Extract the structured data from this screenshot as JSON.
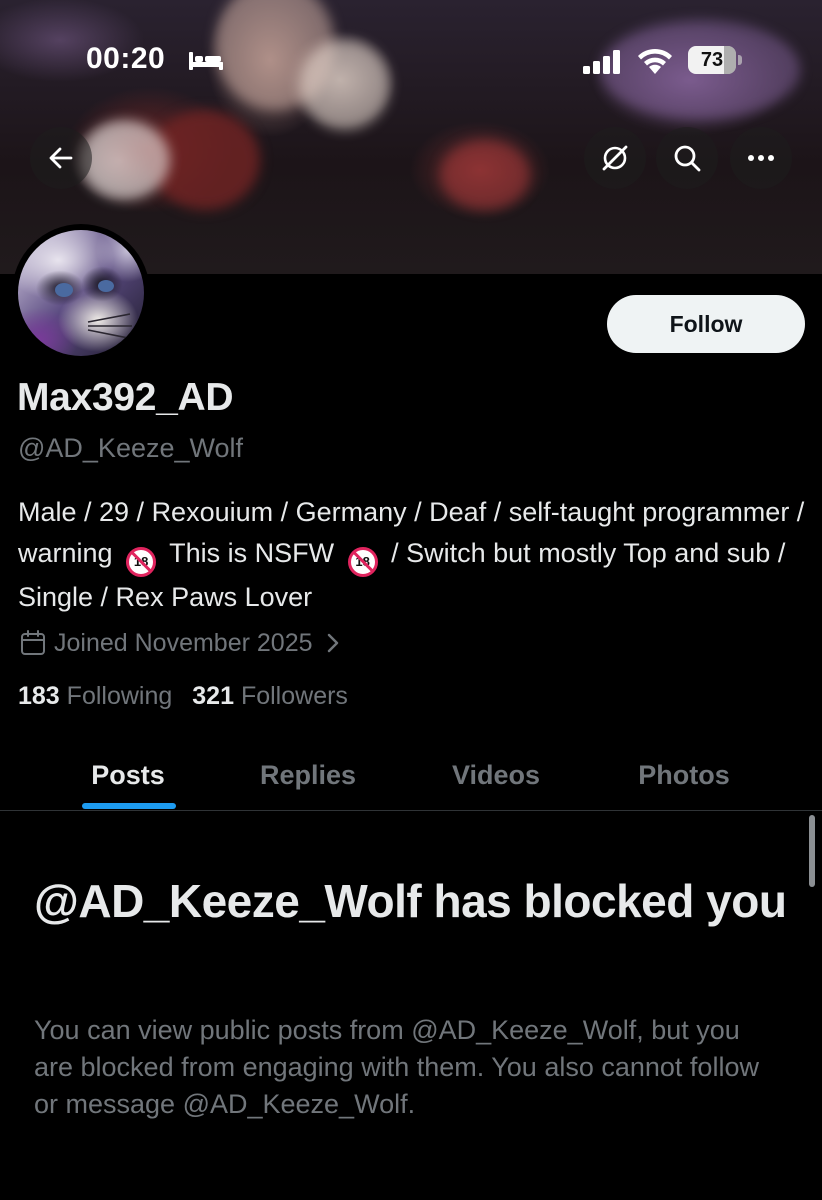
{
  "status_bar": {
    "time": "00:20",
    "battery_level": "73",
    "sleep_icon": "bed-icon",
    "signal_icon": "cellular-signal-icon",
    "wifi_icon": "wifi-icon"
  },
  "header": {
    "back_icon": "arrow-left-icon",
    "grok_icon": "grok-slash-icon",
    "search_icon": "search-icon",
    "more_icon": "more-horizontal-icon"
  },
  "profile": {
    "display_name": "Max392_AD",
    "handle": "@AD_Keeze_Wolf",
    "follow_label": "Follow",
    "bio_part1": "Male / 29 / Rexouium / Germany / Deaf / self-taught programmer / warning",
    "bio_part2": "This is NSFW",
    "bio_part3": "/ Switch but mostly Top and sub / Single / Rex Paws Lover",
    "nsfw_badge_text": "18",
    "joined": "Joined November 2025",
    "following_count": "183",
    "following_label": "Following",
    "followers_count": "321",
    "followers_label": "Followers"
  },
  "tabs": [
    {
      "label": "Posts",
      "active": true
    },
    {
      "label": "Replies",
      "active": false
    },
    {
      "label": "Videos",
      "active": false
    },
    {
      "label": "Photos",
      "active": false
    }
  ],
  "blocked_notice": {
    "title": "@AD_Keeze_Wolf has blocked you",
    "body": "You can view public posts from @AD_Keeze_Wolf, but you are blocked from engaging with them. You also cannot follow or message @AD_Keeze_Wolf."
  },
  "colors": {
    "background": "#000000",
    "primary_text": "#e7e9ea",
    "secondary_text": "#71767b",
    "accent": "#1d9bf0",
    "follow_button_bg": "#eff3f4"
  }
}
